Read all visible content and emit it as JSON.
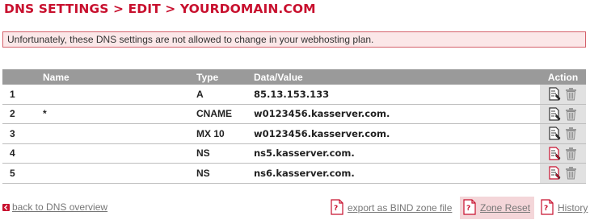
{
  "page": {
    "title": "DNS SETTINGS > EDIT > YOURDOMAIN.COM",
    "alert": "Unfortunately, these DNS settings are not allowed to change in your webhosting plan."
  },
  "table": {
    "headers": {
      "num": "",
      "name": "Name",
      "type": "Type",
      "data": "Data/Value",
      "action": "Action"
    },
    "rows": [
      {
        "num": "1",
        "name": "",
        "type": "A",
        "data": "85.13.153.133",
        "edit_state": "normal"
      },
      {
        "num": "2",
        "name": "*",
        "type": "CNAME",
        "data": "w0123456.kasserver.com.",
        "edit_state": "normal"
      },
      {
        "num": "3",
        "name": "",
        "type": "MX 10",
        "data": "w0123456.kasserver.com.",
        "edit_state": "normal"
      },
      {
        "num": "4",
        "name": "",
        "type": "NS",
        "data": "ns5.kasserver.com.",
        "edit_state": "highlighted"
      },
      {
        "num": "5",
        "name": "",
        "type": "NS",
        "data": "ns6.kasserver.com.",
        "edit_state": "highlighted"
      }
    ]
  },
  "footer": {
    "back": "back to DNS overview",
    "export": "export as BIND zone file",
    "reset": "Zone Reset",
    "history": "History"
  },
  "colors": {
    "accent": "#c8102e",
    "header_bg": "#9a9a9a",
    "alert_bg": "#fbe7e8",
    "action_bg": "#e1e1e1"
  },
  "icons": {
    "edit": "edit-document-icon",
    "delete": "trash-icon",
    "back": "arrow-left-icon",
    "export": "document-question-icon"
  }
}
